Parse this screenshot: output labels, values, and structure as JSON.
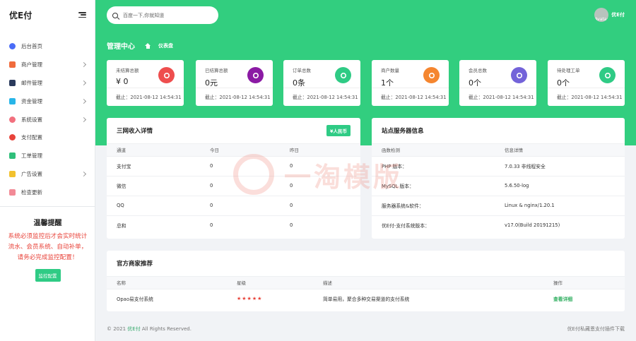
{
  "sidebar": {
    "brand": "优E付",
    "items": [
      {
        "label": "后台首页",
        "icon": "compass-icon",
        "color": "#4a6cf7",
        "chev": false
      },
      {
        "label": "商户管理",
        "icon": "user-icon",
        "color": "#f06b3c",
        "chev": true
      },
      {
        "label": "邮件管理",
        "icon": "mail-icon",
        "color": "#2a3a5c",
        "chev": true
      },
      {
        "label": "资金管理",
        "icon": "card-icon",
        "color": "#27b5e8",
        "chev": true
      },
      {
        "label": "系统设置",
        "icon": "gear-icon",
        "color": "#f2707e",
        "chev": true
      },
      {
        "label": "支付配置",
        "icon": "pay-icon",
        "color": "#e8433a",
        "chev": false
      },
      {
        "label": "工单管理",
        "icon": "send-icon",
        "color": "#2fbf7a",
        "chev": false
      },
      {
        "label": "广告设置",
        "icon": "ad-icon",
        "color": "#f2c12e",
        "chev": true
      },
      {
        "label": "检查更新",
        "icon": "rocket-icon",
        "color": "#f28a96",
        "chev": false
      }
    ],
    "tips": {
      "title": "温馨提醒",
      "text": "系统必须监控后才会实时统计流水、会员系统、自动补单，请务必完成监控配置！",
      "button": "监控配置"
    }
  },
  "header": {
    "search_placeholder": "百度一下,你就知道",
    "avatar_alt": "Avatar",
    "username": "优E付"
  },
  "breadcrumb": {
    "title": "管理中心",
    "current": "仪表盘"
  },
  "stats": [
    {
      "label": "未结算总额",
      "value": "¥ 0",
      "time": "截止：2021-08-12 14:54:31",
      "color": "#ee4e4e",
      "icon": "pie-icon"
    },
    {
      "label": "已结算总额",
      "value": "0元",
      "time": "截止：2021-08-12 14:54:31",
      "color": "#8b1aa4",
      "icon": "wallet-icon"
    },
    {
      "label": "订单总数",
      "value": "0条",
      "time": "截止：2021-08-12 14:54:31",
      "color": "#2fcb85",
      "icon": "cart-icon"
    },
    {
      "label": "商户数量",
      "value": "1个",
      "time": "截止：2021-08-12 14:54:31",
      "color": "#f5862f",
      "icon": "face-icon"
    },
    {
      "label": "会员总数",
      "value": "0个",
      "time": "截止：2021-08-12 14:54:31",
      "color": "#7363d9",
      "icon": "cube-icon"
    },
    {
      "label": "待处理工单",
      "value": "0个",
      "time": "截止：2021-08-12 14:54:31",
      "color": "#2fcb85",
      "icon": "paper-plane-icon"
    }
  ],
  "income": {
    "title": "三网收入详情",
    "badge": "¥人民币",
    "headers": [
      "通道",
      "今日",
      "昨日"
    ],
    "rows": [
      [
        "支付宝",
        "0",
        "0"
      ],
      [
        "微信",
        "0",
        "0"
      ],
      [
        "QQ",
        "0",
        "0"
      ],
      [
        "总和",
        "0",
        "0"
      ]
    ]
  },
  "server": {
    "title": "站点服务器信息",
    "headers": [
      "函数检测",
      "信息详情"
    ],
    "rows": [
      [
        "PHP 版本：",
        "7.0.33 非线程安全"
      ],
      [
        "MySQL 版本：",
        "5.6.50-log"
      ],
      [
        "服务器系统&软件：",
        "Linux & nginx/1.20.1"
      ],
      [
        "优E付-支付系统版本：",
        "v17.0(Build 20191215)"
      ]
    ]
  },
  "merchants": {
    "title": "官方商家推荐",
    "headers": [
      "名称",
      "星级",
      "描述",
      "操作"
    ],
    "rows": [
      {
        "name": "Opao易支付系统",
        "stars": "★★★★★",
        "desc": "简单易用，聚合多种交易渠道的支付系统",
        "action": "查看详细"
      }
    ]
  },
  "footer": {
    "prefix": "© 2021 ",
    "brand": "优E付",
    "suffix": " All Rights Reserved.",
    "right": "优E付私藏恩支付插件下载"
  },
  "watermark": "一淘模版"
}
